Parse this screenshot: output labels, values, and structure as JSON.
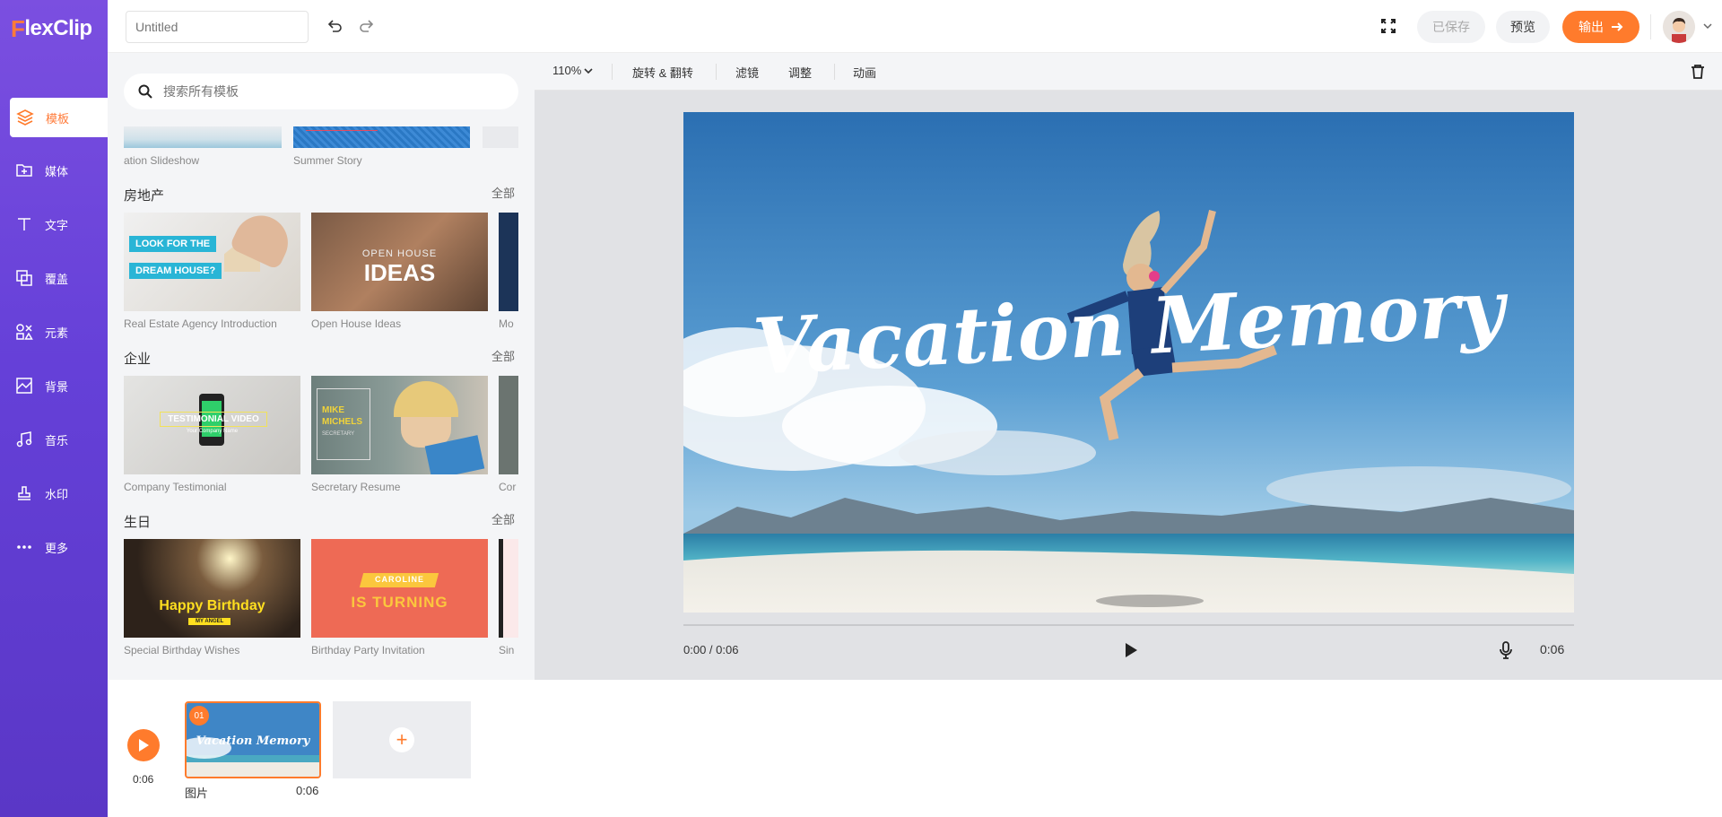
{
  "app": {
    "logo_text": "lexClip",
    "logo_accent": "F",
    "brand_color": "#ff7b2c",
    "sidebar_color": "#6a45dc"
  },
  "sidebar": {
    "items": [
      {
        "label": "模板",
        "icon": "layers-icon",
        "active": true
      },
      {
        "label": "媒体",
        "icon": "folder-plus-icon"
      },
      {
        "label": "文字",
        "icon": "text-icon"
      },
      {
        "label": "覆盖",
        "icon": "overlay-icon"
      },
      {
        "label": "元素",
        "icon": "elements-icon"
      },
      {
        "label": "背景",
        "icon": "background-icon"
      },
      {
        "label": "音乐",
        "icon": "music-icon"
      },
      {
        "label": "水印",
        "icon": "stamp-icon"
      },
      {
        "label": "更多",
        "icon": "more-icon"
      }
    ]
  },
  "header": {
    "title_placeholder": "Untitled",
    "saved_label": "已保存",
    "preview_label": "预览",
    "export_label": "输出"
  },
  "panel": {
    "search_placeholder": "搜索所有模板",
    "top_row": [
      "ation Slideshow",
      "Summer Story"
    ],
    "all_label": "全部",
    "categories": [
      {
        "title": "房地产",
        "items": [
          "Real Estate Agency Introduction",
          "Open House Ideas",
          "Mo"
        ]
      },
      {
        "title": "企业",
        "items": [
          "Company Testimonial",
          "Secretary Resume",
          "Cor"
        ]
      },
      {
        "title": "生日",
        "items": [
          "Special Birthday Wishes",
          "Birthday Party Invitation",
          "Sin"
        ]
      }
    ],
    "thumb_texts": {
      "look_for": "LOOK FOR THE",
      "dream_house": "DREAM HOUSE?",
      "open_house": "OPEN HOUSE",
      "ideas": "IDEAS",
      "testimonial": "TESTIMONIAL VIDEO",
      "testimonial_sub": "Your Company Name",
      "mike": "MIKE",
      "michels": "MICHELS",
      "secretary": "SECRETARY",
      "happy_birthday": "Happy Birthday",
      "birthday_sub": "MY ANGEL",
      "caroline": "CAROLINE",
      "is_turning": "IS TURNING"
    }
  },
  "toolbar": {
    "zoom": "110%",
    "rotate_flip": "旋转 & 翻转",
    "filter": "滤镜",
    "adjust": "调整",
    "animation": "动画"
  },
  "canvas": {
    "title_text": "Vacation Memory"
  },
  "player": {
    "current": "0:00 / 0:06",
    "duration": "0:06"
  },
  "timeline": {
    "total_duration": "0:06",
    "clips": [
      {
        "number": "01",
        "label": "图片",
        "duration": "0:06",
        "thumb_text": "Vacation Memory"
      }
    ]
  }
}
